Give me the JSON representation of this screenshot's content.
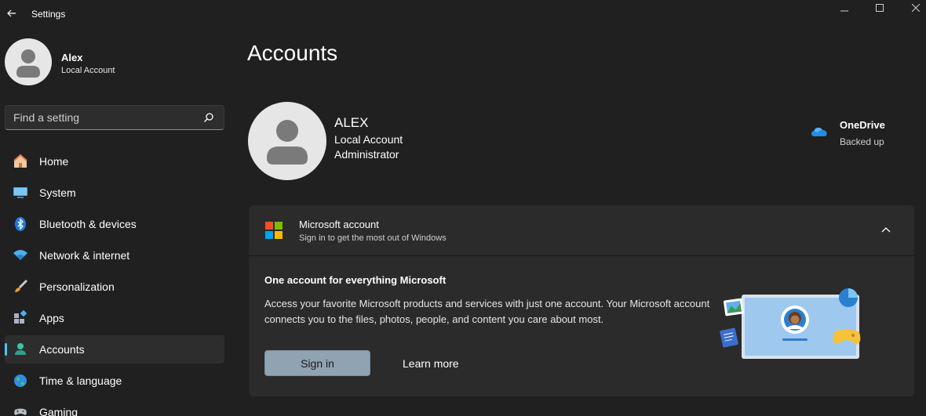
{
  "window": {
    "title": "Settings"
  },
  "user": {
    "name": "Alex",
    "account_type": "Local Account"
  },
  "search": {
    "placeholder": "Find a setting"
  },
  "nav": {
    "items": [
      {
        "label": "Home",
        "icon": "home-icon"
      },
      {
        "label": "System",
        "icon": "system-icon"
      },
      {
        "label": "Bluetooth & devices",
        "icon": "bluetooth-icon"
      },
      {
        "label": "Network & internet",
        "icon": "wifi-icon"
      },
      {
        "label": "Personalization",
        "icon": "brush-icon"
      },
      {
        "label": "Apps",
        "icon": "apps-icon"
      },
      {
        "label": "Accounts",
        "icon": "accounts-icon",
        "active": true
      },
      {
        "label": "Time & language",
        "icon": "globe-icon"
      },
      {
        "label": "Gaming",
        "icon": "gamepad-icon"
      }
    ]
  },
  "page": {
    "title": "Accounts"
  },
  "profile": {
    "name": "ALEX",
    "account_type": "Local Account",
    "role": "Administrator"
  },
  "onedrive": {
    "title": "OneDrive",
    "status": "Backed up"
  },
  "microsoft_account": {
    "title": "Microsoft account",
    "subtitle": "Sign in to get the most out of Windows",
    "body_title": "One account for everything Microsoft",
    "body_text": "Access your favorite Microsoft products and services with just one account. Your Microsoft account connects you to the files, photos, people, and content you care about most.",
    "signin_label": "Sign in",
    "learn_more_label": "Learn more"
  },
  "colors": {
    "background": "#202020",
    "card": "#2b2b2b",
    "accent": "#4cc2ff",
    "signin_button": "#8fa3b2"
  }
}
